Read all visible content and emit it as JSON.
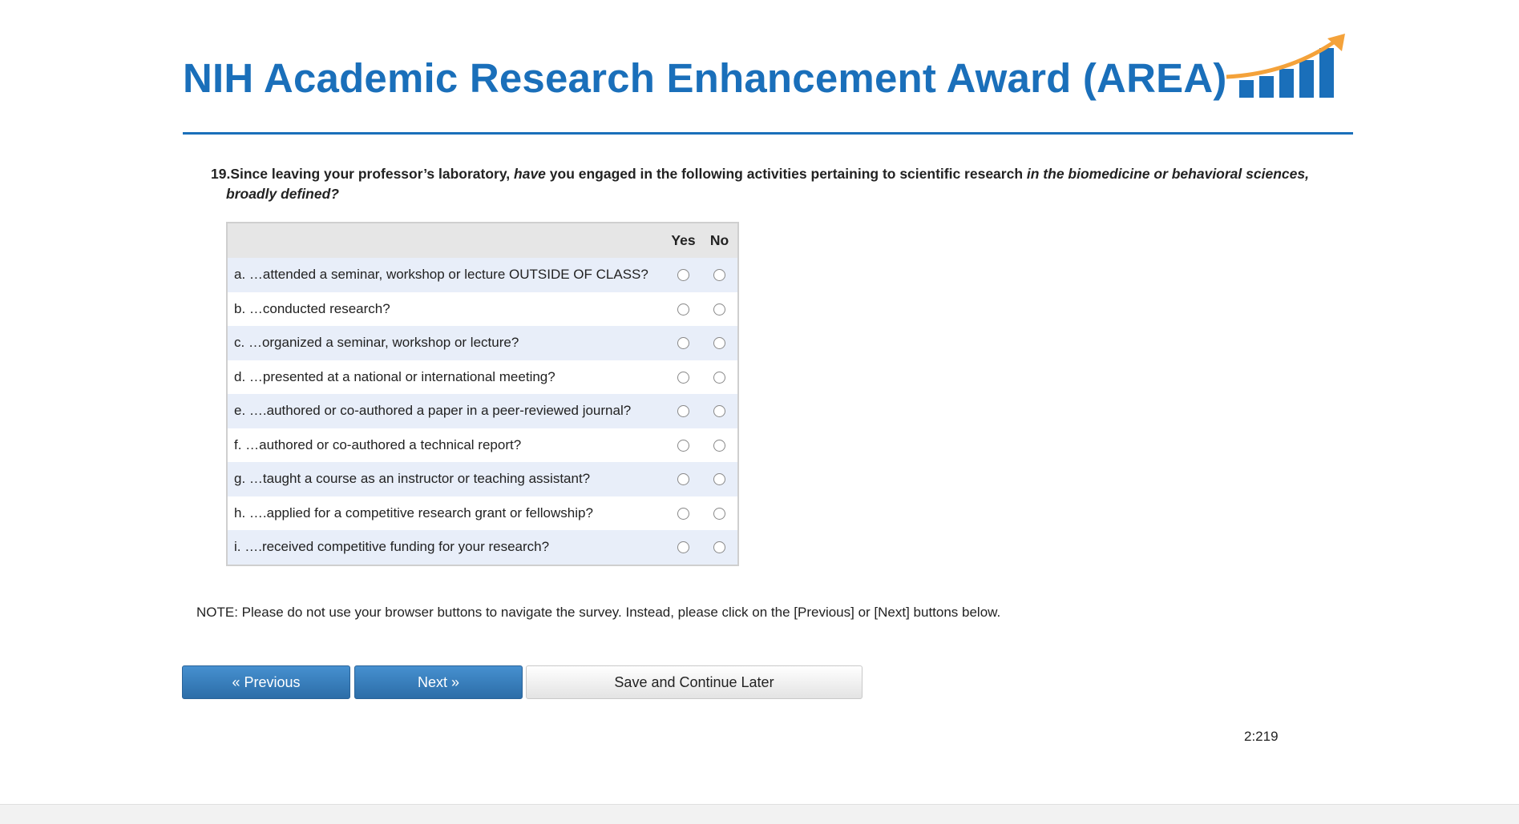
{
  "header": {
    "title": "NIH Academic Research Enhancement Award (AREA)",
    "logo_icon": "rising-bar-chart-icon"
  },
  "question": {
    "number": "19.",
    "part1": "Since leaving your professor’s laboratory, ",
    "part2": "have",
    "part3": " you engaged in the following activities pertaining to scientific research ",
    "part4": "in the biomedicine or behavioral sciences,",
    "part5": "broadly defined?"
  },
  "grid": {
    "columns": [
      "Yes",
      "No"
    ],
    "rows": [
      {
        "label": "a. …attended a seminar, workshop or lecture OUTSIDE OF CLASS?"
      },
      {
        "label": "b. …conducted research?"
      },
      {
        "label": "c. …organized a seminar, workshop or lecture?"
      },
      {
        "label": "d. …presented at a national or international meeting?"
      },
      {
        "label": "e. ….authored or co-authored a paper in a peer-reviewed journal?"
      },
      {
        "label": "f. …authored or co-authored a technical report?"
      },
      {
        "label": "g. …taught a course as an instructor or teaching assistant?"
      },
      {
        "label": "h. ….applied for a competitive research grant or fellowship?"
      },
      {
        "label": "i. ….received competitive funding for your research?"
      }
    ]
  },
  "note": "NOTE: Please do not use your browser buttons to navigate the survey. Instead, please click on the [Previous] or [Next] buttons below.",
  "buttons": {
    "previous": "« Previous",
    "next": "Next »",
    "save": "Save and Continue Later"
  },
  "page_code": "2:219",
  "colors": {
    "brand": "#1a6fba",
    "arrow": "#f4a23a",
    "row_alt": "#e8eef9"
  }
}
